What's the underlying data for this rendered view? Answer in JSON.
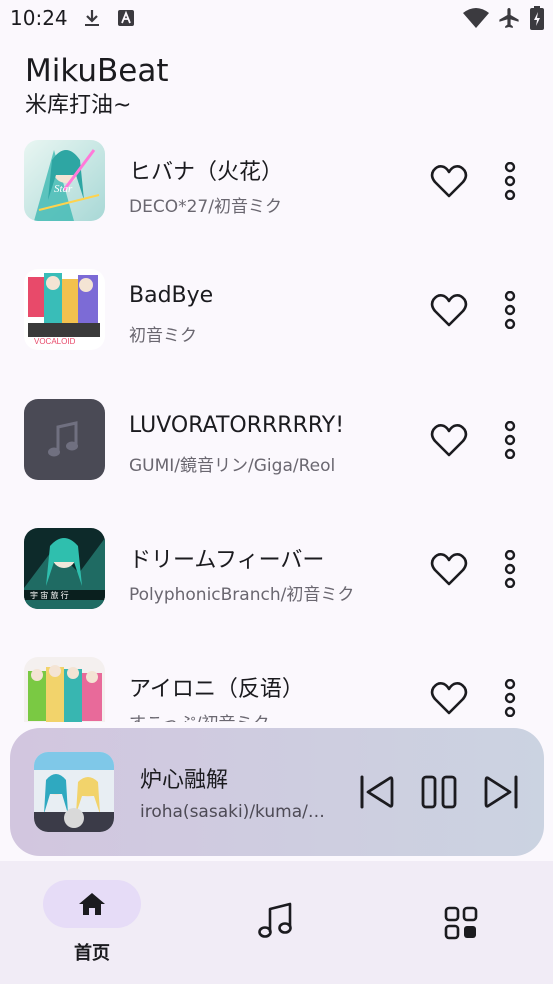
{
  "status_bar": {
    "time": "10:24",
    "left_icons": [
      "download-icon",
      "a-notification-icon"
    ],
    "right_icons": [
      "wifi-icon",
      "airplane-mode-icon",
      "battery-charging-icon"
    ]
  },
  "header": {
    "title": "MikuBeat",
    "subtitle": "米库打油~"
  },
  "songs": [
    {
      "title": "ヒバナ（火花）",
      "artist": "DECO*27/初音ミク",
      "cover": "album-art",
      "favorite_icon": "heart-outline-icon",
      "more_icon": "more-vert-icon"
    },
    {
      "title": "BadBye",
      "artist": "初音ミク",
      "cover": "album-art",
      "favorite_icon": "heart-outline-icon",
      "more_icon": "more-vert-icon"
    },
    {
      "title": "LUVORATORRRRRY!",
      "artist": "GUMI/鏡音リン/Giga/Reol",
      "cover": "music-note-placeholder-icon",
      "favorite_icon": "heart-outline-icon",
      "more_icon": "more-vert-icon"
    },
    {
      "title": "ドリームフィーバー",
      "artist": "PolyphonicBranch/初音ミク",
      "cover": "album-art",
      "favorite_icon": "heart-outline-icon",
      "more_icon": "more-vert-icon"
    },
    {
      "title": "アイロニ（反语）",
      "artist": "すこっぷ/初音ミク",
      "cover": "album-art",
      "favorite_icon": "heart-outline-icon",
      "more_icon": "more-vert-icon"
    }
  ],
  "now_playing": {
    "title": "炉心融解",
    "artist": "iroha(sasaki)/kuma/…",
    "controls": [
      "skip-previous-icon",
      "pause-icon",
      "skip-next-icon"
    ]
  },
  "bottom_nav": {
    "items": [
      {
        "icon": "home-icon",
        "label": "首页",
        "selected": true
      },
      {
        "icon": "music-note-icon",
        "label": "",
        "selected": false
      },
      {
        "icon": "grid-apps-icon",
        "label": "",
        "selected": false
      }
    ]
  },
  "colors": {
    "background": "#fbf8fd",
    "player_gradient_start": "#d2c6df",
    "player_gradient_end": "#cbd3e1",
    "nav_background": "#f1ecf6",
    "nav_selected_pill": "#e6dcf7",
    "secondary_text": "#6a6770"
  }
}
